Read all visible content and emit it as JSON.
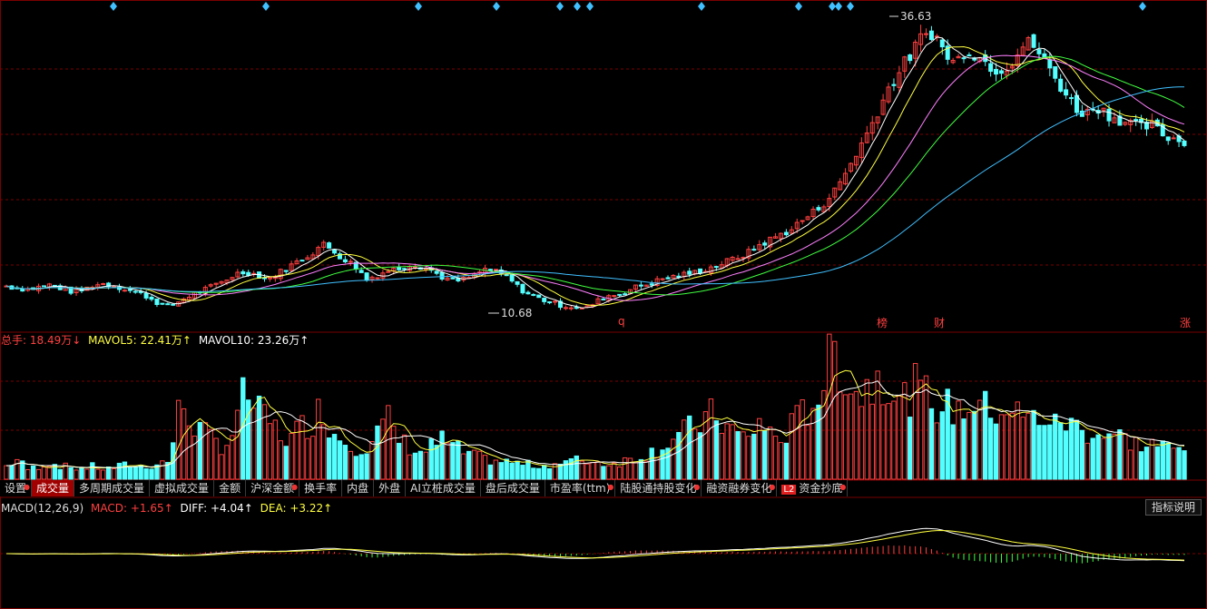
{
  "colors": {
    "up": "#ff4040",
    "down": "#54ffff",
    "ma5": "#ffffff",
    "ma10": "#ffff40",
    "ma20": "#ff80ff",
    "ma30": "#40ff40",
    "ma60": "#40c0ff",
    "grid": "#7a0000",
    "diff": "#ffffff",
    "dea": "#ffff40"
  },
  "price_panel": {
    "high_label": "36.63",
    "low_label": "10.68",
    "marker_q": "q",
    "marker_bang": "榜",
    "marker_cai": "财",
    "marker_zhang": "涨"
  },
  "volume_panel": {
    "total_label": "总手:",
    "total_value": "18.49万↓",
    "mavol5_label": "MAVOL5:",
    "mavol5_value": "22.41万↑",
    "mavol10_label": "MAVOL10:",
    "mavol10_value": "23.26万↑"
  },
  "tabs": [
    {
      "label": "设置",
      "dot": true
    },
    {
      "label": "成交量",
      "active": true
    },
    {
      "label": "多周期成交量"
    },
    {
      "label": "虚拟成交量"
    },
    {
      "label": "金额"
    },
    {
      "label": "沪深金额",
      "dot": true
    },
    {
      "label": "换手率"
    },
    {
      "label": "内盘"
    },
    {
      "label": "外盘"
    },
    {
      "label": "AI立桩成交量"
    },
    {
      "label": "盘后成交量"
    },
    {
      "label": "市盈率(ttm)",
      "dot": true
    },
    {
      "label": "陆股通持股变化",
      "dot": true
    },
    {
      "label": "融资融券变化",
      "dot": true
    },
    {
      "label": "资金抄底",
      "dot": true,
      "badge": "L2"
    }
  ],
  "macd_panel": {
    "title": "MACD(12,26,9)",
    "macd_label": "MACD:",
    "macd_value": "+1.65↑",
    "diff_label": "DIFF:",
    "diff_value": "+4.04↑",
    "dea_label": "DEA:",
    "dea_value": "+3.22↑",
    "help_button": "指标说明"
  },
  "chart_data": {
    "type": "candlestick",
    "price_range": [
      9.5,
      38
    ],
    "high": 36.63,
    "low": 10.68,
    "close_path": [
      12.8,
      12.6,
      12.5,
      12.7,
      12.9,
      12.6,
      12.3,
      12.4,
      12.9,
      13.0,
      12.8,
      12.5,
      12.2,
      11.8,
      11.2,
      10.9,
      11.5,
      12.0,
      12.4,
      12.8,
      13.3,
      13.9,
      14.1,
      13.8,
      13.4,
      14.0,
      14.6,
      15.2,
      15.8,
      16.6,
      16.0,
      15.2,
      14.6,
      13.4,
      13.8,
      14.2,
      14.4,
      14.8,
      14.6,
      14.2,
      13.6,
      13.2,
      13.4,
      13.8,
      14.4,
      14.0,
      13.6,
      12.6,
      12.0,
      11.6,
      11.3,
      11.0,
      10.9,
      10.7,
      11.3,
      11.9,
      12.0,
      12.4,
      12.8,
      13.0,
      13.4,
      13.6,
      13.8,
      14.0,
      14.3,
      14.6,
      15.0,
      15.4,
      15.8,
      16.5,
      17.0,
      17.5,
      18.0,
      18.8,
      19.5,
      20.4,
      21.5,
      23.2,
      25.0,
      26.8,
      29.0,
      31.0,
      32.5,
      34.0,
      35.5,
      36.0,
      34.0,
      33.0,
      34.5,
      33.8,
      33.0,
      32.5,
      33.0,
      34.5,
      35.0,
      33.5,
      32.0,
      30.5,
      29.0,
      28.5,
      29.2,
      28.4,
      28.0,
      27.6,
      27.2,
      27.4,
      26.6,
      26.2,
      26.0
    ],
    "ma_periods": [
      5,
      10,
      20,
      30,
      60
    ],
    "volume_range": [
      0,
      20
    ],
    "volume_path": [
      2,
      3,
      1.5,
      2,
      2.5,
      2,
      1.8,
      1.6,
      2,
      1.5,
      1.8,
      2.2,
      2,
      1.9,
      2.4,
      3,
      12,
      9,
      7,
      6,
      5,
      8,
      14,
      10,
      9,
      7,
      6,
      8,
      9,
      11,
      7,
      6,
      5,
      5,
      7,
      9,
      6,
      5,
      4,
      5,
      6,
      5,
      4,
      3.5,
      3,
      2.8,
      2.6,
      2.4,
      2.2,
      2,
      2.3,
      2.5,
      2.8,
      3,
      2.6,
      2.4,
      2.5,
      3,
      3.5,
      4,
      5,
      6,
      7,
      8,
      9,
      10,
      8,
      7,
      6,
      9,
      7,
      6,
      8,
      10,
      12,
      15,
      20,
      16,
      13,
      14,
      17,
      15,
      11,
      14,
      13,
      12,
      11,
      10.5,
      11,
      12.5,
      10,
      11,
      11,
      9.5,
      9,
      10,
      8,
      9,
      8,
      7.5,
      7,
      7,
      6.5,
      6,
      5,
      5.5,
      5,
      4.5,
      4.5
    ],
    "macd_range": [
      -3,
      6
    ]
  }
}
